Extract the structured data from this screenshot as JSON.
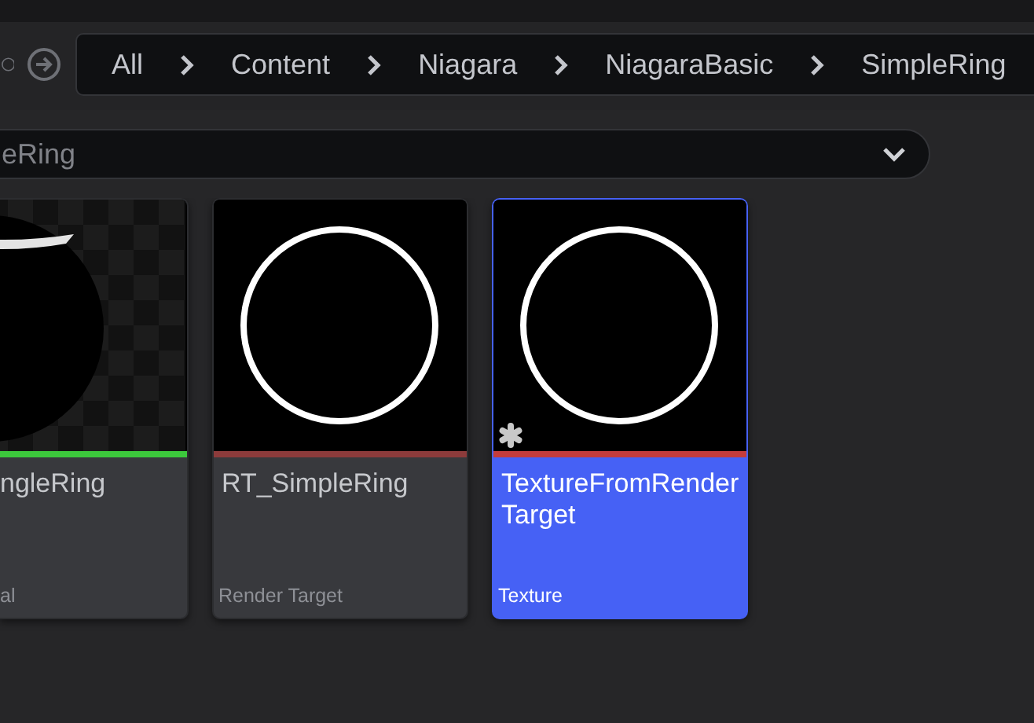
{
  "path": [
    "All",
    "Content",
    "Niagara",
    "NiagaraBasic",
    "SimpleRing"
  ],
  "search": {
    "value": "eRing"
  },
  "assets": [
    {
      "name": "ngleRing",
      "type": "al",
      "kind": "sphere",
      "color": "#3cc83c",
      "selected": false,
      "dirty": false
    },
    {
      "name": "RT_SimpleRing",
      "type": "Render Target",
      "kind": "ring",
      "color": "#8c3b3b",
      "selected": false,
      "dirty": false
    },
    {
      "name": "TextureFromRenderTarget",
      "type": "Texture",
      "kind": "ring",
      "color": "#c43c3c",
      "selected": true,
      "dirty": true
    }
  ]
}
